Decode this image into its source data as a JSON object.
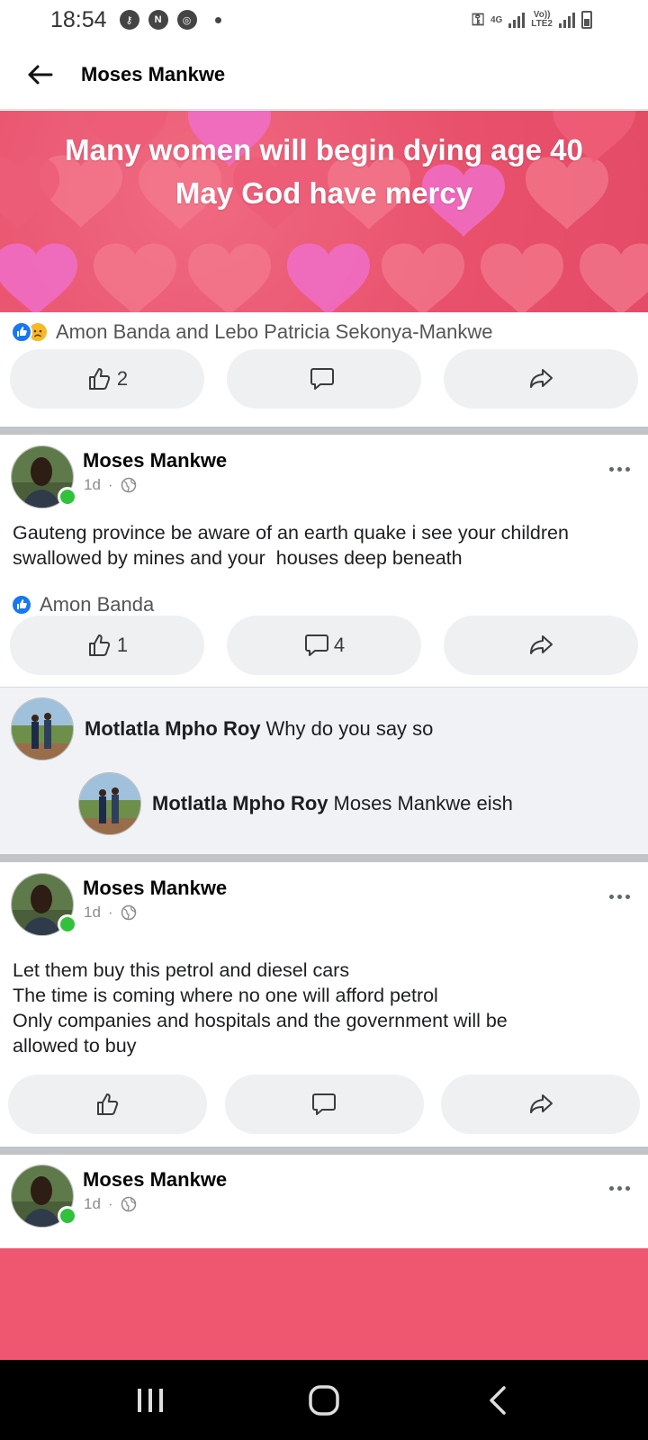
{
  "status_bar": {
    "time": "18:54",
    "network_top": "4G",
    "volte_label": "Vo))",
    "lte_label": "LTE2"
  },
  "header": {
    "title": "Moses Mankwe"
  },
  "banner": {
    "line1": "Many women will begin dying age 40",
    "line2": "May God have mercy"
  },
  "post1": {
    "reactions_text": "Amon Banda and Lebo Patricia Sekonya-Mankwe",
    "like_count": "2",
    "comment_count": "",
    "icons": [
      "like-reaction-icon",
      "sad-reaction-icon"
    ]
  },
  "post2": {
    "author": "Moses Mankwe",
    "time": "1d",
    "text_lines": [
      "Gauteng province be aware of an earth quake i see your children",
      "swallowed by mines and your  houses deep beneath"
    ],
    "reactions_text": "Amon Banda",
    "like_count": "1",
    "comment_count": "4"
  },
  "comments": [
    {
      "name": "Motlatla Mpho Roy",
      "text": "Why do you say so"
    },
    {
      "name": "Motlatla Mpho Roy",
      "text": "Moses Mankwe eish"
    }
  ],
  "post3": {
    "author": "Moses Mankwe",
    "time": "1d",
    "text_lines": [
      "Let them buy this petrol and diesel cars",
      "The time is coming where no one will afford petrol",
      "Only companies and hospitals and the government will be",
      "allowed to buy"
    ]
  },
  "post4": {
    "author": "Moses Mankwe",
    "time": "1d"
  },
  "colors": {
    "accent": "#1877f2",
    "banner_pink": "#e8506b",
    "online_green": "#31c23c"
  }
}
